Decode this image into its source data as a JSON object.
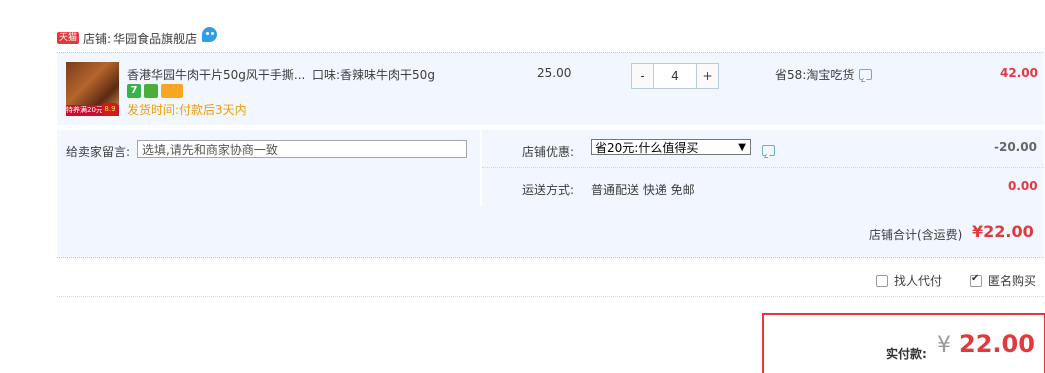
{
  "shop": {
    "badge": "天猫",
    "label": "店铺:",
    "name": "华园食品旗舰店",
    "chat_icon": "wangwang-icon"
  },
  "item": {
    "thumb_strip_text": "特养满20元",
    "thumb_price": "8.9",
    "title": "香港华园牛肉干片50g风干手撕...",
    "spec": "口味:香辣味牛肉干50g",
    "badge_seven": "7",
    "ship_time": "发货时间:付款后3天内",
    "unit_price": "25.00",
    "quantity": "4",
    "qty_minus": "-",
    "qty_plus": "+",
    "promo": "省58:淘宝吃货",
    "line_total": "42.00"
  },
  "message": {
    "label": "给卖家留言:",
    "placeholder": "选填,请先和商家协商一致"
  },
  "discount": {
    "label": "店铺优惠:",
    "selected": "省20元:什么值得买",
    "arrow": "▼",
    "value": "-20.00"
  },
  "delivery": {
    "label": "运送方式:",
    "value": "普通配送 快递 免邮",
    "fee": "0.00"
  },
  "subtotal": {
    "label": "店铺合计(含运费)",
    "value": "¥22.00"
  },
  "options": {
    "proxy_pay": "找人代付",
    "proxy_pay_checked": false,
    "anonymous": "匿名购买",
    "anonymous_checked": true
  },
  "payment": {
    "label": "实付款:",
    "currency": "¥",
    "value": "22.00"
  },
  "colors": {
    "accent_red": "#e4393c",
    "row_bg": "#f2f7ff",
    "ship_orange": "#f29d0a"
  }
}
